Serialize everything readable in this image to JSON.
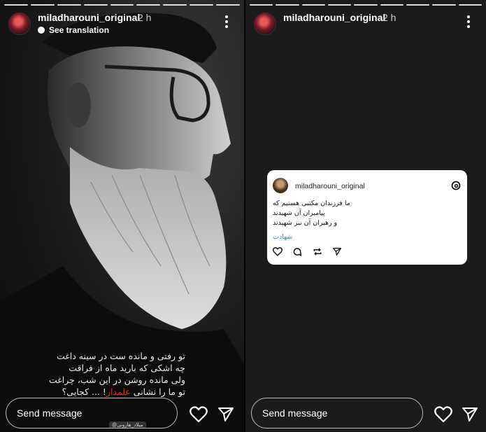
{
  "left_story": {
    "username": "miladharouni_original",
    "time": "2 h",
    "translate_label": "See translation",
    "poem": [
      "تو رفتی و مانده ست در سینه داغت",
      "چه اشکی که بارید ماه از فراقت",
      "ولی مانده روشن در این شب، چراغت",
      "تو ما را نشانی علمدار! ... کجایی؟"
    ],
    "poem_highlight": "علمدار",
    "credit": "@میلاد_هارونی",
    "send_placeholder": "Send message"
  },
  "right_story": {
    "username": "miladharouni_original",
    "time": "2 h",
    "send_placeholder": "Send message",
    "threads_post": {
      "username": "miladharouni_original",
      "lines": [
        "ما فرزندان مکتبی هستیم که",
        "پیامبران آن شهیدند",
        "و رهبران آن نیز شهیدند"
      ],
      "hashtag": "شهادت"
    }
  },
  "colors": {
    "story_bg": "#151517",
    "link_blue": "#3b8fd6",
    "highlight_red": "#e02a2a"
  }
}
